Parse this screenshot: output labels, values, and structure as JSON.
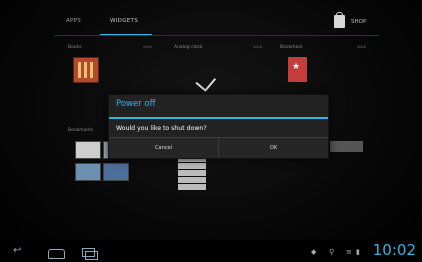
{
  "tabs": {
    "apps_label": "APPS",
    "widgets_label": "WIDGETS",
    "active": "widgets",
    "accent_color": "#33b5e5"
  },
  "shop": {
    "label": "SHOP",
    "icon": "shopping-bag-icon"
  },
  "widgets": {
    "labels": [
      "Books",
      "Analog clock",
      "Bookmark",
      "Bookmarks"
    ]
  },
  "dialog": {
    "title": "Power off",
    "message": "Would you like to shut down?",
    "cancel_label": "Cancel",
    "ok_label": "OK"
  },
  "status_bar": {
    "time": "10:02",
    "icons": [
      "back-icon",
      "home-icon",
      "recent-apps-icon",
      "android-debug-icon",
      "usb-icon",
      "wifi-icon",
      "battery-icon"
    ]
  }
}
